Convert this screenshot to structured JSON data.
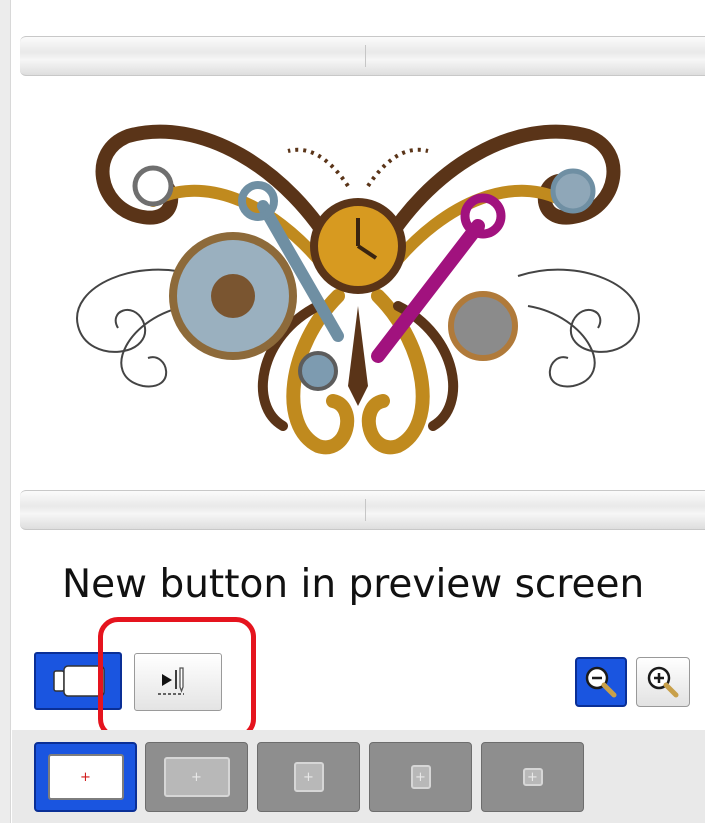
{
  "caption": "New button in preview screen",
  "toolbar": {
    "view_button_icon": "hoop-view-icon",
    "simulator_button_icon": "stitch-simulator-icon",
    "zoom_out_icon": "zoom-out-icon",
    "zoom_in_icon": "zoom-in-icon"
  },
  "hoop_buttons": [
    {
      "label": "+",
      "selected": true
    },
    {
      "label": "+",
      "selected": false
    },
    {
      "label": "+",
      "selected": false
    },
    {
      "label": "+",
      "selected": false
    },
    {
      "label": "+",
      "selected": false
    }
  ],
  "colors": {
    "selected_blue": "#1a55e0",
    "highlight_red": "#e5141e",
    "thread_brown": "#5a3418",
    "thread_gold": "#c08a1e",
    "thread_magenta": "#a1127e",
    "thread_steel": "#6f8fa3"
  }
}
